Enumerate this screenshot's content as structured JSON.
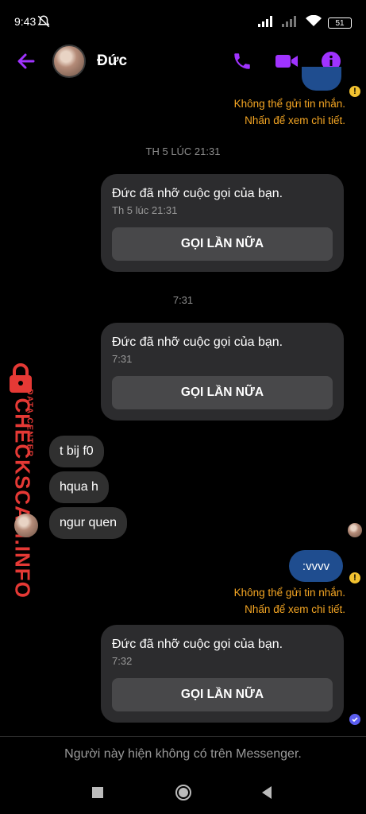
{
  "status": {
    "time": "9:43",
    "battery": "51"
  },
  "header": {
    "contact_name": "Đức"
  },
  "messages": {
    "fail_line1": "Không thể gửi tin nhắn.",
    "fail_line2": "Nhấn để xem chi tiết.",
    "timestamp1": "TH 5 LÚC 21:31",
    "call1": {
      "title": "Đức đã nhỡ cuộc gọi của bạn.",
      "time": "Th 5 lúc 21:31",
      "button": "GỌI LẦN NỮA"
    },
    "timestamp2": "7:31",
    "call2": {
      "title": "Đức đã nhỡ cuộc gọi của bạn.",
      "time": "7:31",
      "button": "GỌI LẦN NỮA"
    },
    "received": [
      "t bij f0",
      "hqua h",
      "ngur quen"
    ],
    "sent_text": ":vvvv",
    "fail2_line1": "Không thể gửi tin nhắn.",
    "fail2_line2": "Nhấn để xem chi tiết.",
    "call3": {
      "title": "Đức đã nhỡ cuộc gọi của bạn.",
      "time": "7:32",
      "button": "GỌI LẦN NỮA"
    }
  },
  "watermark": {
    "big": "CHECKSCAM.INFO",
    "small": "DATA CENTER"
  },
  "footer": {
    "note": "Người này hiện không có trên Messenger."
  },
  "colors": {
    "accent": "#a033ff",
    "sent_bubble": "#1f4d8f",
    "warning": "#f5a623"
  }
}
